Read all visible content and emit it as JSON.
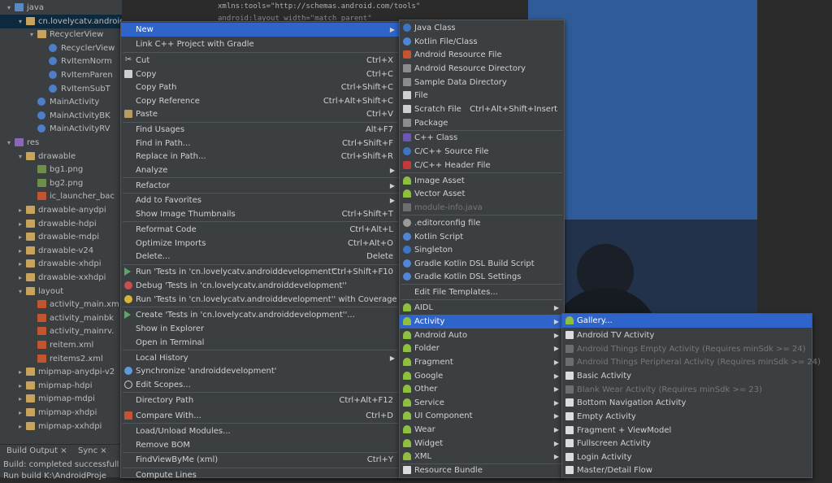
{
  "code": {
    "line1": "xmlns:tools=\"http://schemas.android.com/tools\"",
    "line2": "android:layout_width=\"match_parent\""
  },
  "tree": {
    "items": [
      {
        "label": "java",
        "icon": "folder-blue-icon",
        "arrow": "down"
      },
      {
        "label": "cn.lovelycatv.androiddevelop",
        "icon": "package-icon",
        "arrow": "down"
      },
      {
        "label": "RecyclerView",
        "icon": "folder-icon",
        "arrow": "down"
      },
      {
        "label": "RecyclerView",
        "icon": "kotlin-class-icon",
        "arrow": ""
      },
      {
        "label": "RvItemNorm",
        "icon": "kotlin-class-icon",
        "arrow": ""
      },
      {
        "label": "RvItemParen",
        "icon": "kotlin-class-icon",
        "arrow": ""
      },
      {
        "label": "RvItemSubT",
        "icon": "kotlin-class-icon",
        "arrow": ""
      },
      {
        "label": "MainActivity",
        "icon": "kotlin-class-icon",
        "arrow": ""
      },
      {
        "label": "MainActivityBK",
        "icon": "kotlin-class-icon",
        "arrow": ""
      },
      {
        "label": "MainActivityRV",
        "icon": "kotlin-class-icon",
        "arrow": ""
      },
      {
        "label": "res",
        "icon": "res-folder-icon",
        "arrow": "down"
      },
      {
        "label": "drawable",
        "icon": "folder-icon",
        "arrow": "down"
      },
      {
        "label": "bg1.png",
        "icon": "image-file-icon",
        "arrow": ""
      },
      {
        "label": "bg2.png",
        "icon": "image-file-icon",
        "arrow": ""
      },
      {
        "label": "ic_launcher_bac",
        "icon": "xml-file-icon",
        "arrow": ""
      },
      {
        "label": "drawable-anydpi",
        "icon": "folder-icon",
        "arrow": "right"
      },
      {
        "label": "drawable-hdpi",
        "icon": "folder-icon",
        "arrow": "right"
      },
      {
        "label": "drawable-mdpi",
        "icon": "folder-icon",
        "arrow": "right"
      },
      {
        "label": "drawable-v24",
        "icon": "folder-icon",
        "arrow": "right"
      },
      {
        "label": "drawable-xhdpi",
        "icon": "folder-icon",
        "arrow": "right"
      },
      {
        "label": "drawable-xxhdpi",
        "icon": "folder-icon",
        "arrow": "right"
      },
      {
        "label": "layout",
        "icon": "folder-icon",
        "arrow": "down"
      },
      {
        "label": "activity_main.xm",
        "icon": "xml-file-icon",
        "arrow": ""
      },
      {
        "label": "activity_mainbk",
        "icon": "xml-file-icon",
        "arrow": ""
      },
      {
        "label": "activity_mainrv.",
        "icon": "xml-file-icon",
        "arrow": ""
      },
      {
        "label": "reitem.xml",
        "icon": "xml-file-icon",
        "arrow": ""
      },
      {
        "label": "reitems2.xml",
        "icon": "xml-file-icon",
        "arrow": ""
      },
      {
        "label": "mipmap-anydpi-v2",
        "icon": "folder-icon",
        "arrow": "right"
      },
      {
        "label": "mipmap-hdpi",
        "icon": "folder-icon",
        "arrow": "right"
      },
      {
        "label": "mipmap-mdpi",
        "icon": "folder-icon",
        "arrow": "right"
      },
      {
        "label": "mipmap-xhdpi",
        "icon": "folder-icon",
        "arrow": "right"
      },
      {
        "label": "mipmap-xxhdpi",
        "icon": "folder-icon",
        "arrow": "right"
      }
    ]
  },
  "bottom": {
    "tab_build_output": "Build Output",
    "tab_sync": "Sync",
    "close_glyph": "×",
    "line1": "Build: completed successfull",
    "line2": "Run build K:\\AndroidProje"
  },
  "context_menu": {
    "new": "New",
    "link_cpp": "Link C++ Project with Gradle",
    "cut": "Cut",
    "cut_sc": "Ctrl+X",
    "copy": "Copy",
    "copy_sc": "Ctrl+C",
    "copy_path": "Copy Path",
    "copy_path_sc": "Ctrl+Shift+C",
    "copy_ref": "Copy Reference",
    "copy_ref_sc": "Ctrl+Alt+Shift+C",
    "paste": "Paste",
    "paste_sc": "Ctrl+V",
    "find_usages": "Find Usages",
    "find_usages_sc": "Alt+F7",
    "find_in_path": "Find in Path...",
    "find_in_path_sc": "Ctrl+Shift+F",
    "replace_in_path": "Replace in Path...",
    "replace_in_path_sc": "Ctrl+Shift+R",
    "analyze": "Analyze",
    "refactor": "Refactor",
    "add_favorites": "Add to Favorites",
    "show_thumbs": "Show Image Thumbnails",
    "show_thumbs_sc": "Ctrl+Shift+T",
    "reformat": "Reformat Code",
    "reformat_sc": "Ctrl+Alt+L",
    "optimize": "Optimize Imports",
    "optimize_sc": "Ctrl+Alt+O",
    "delete": "Delete...",
    "delete_sc": "Delete",
    "run_tests": "Run 'Tests in 'cn.lovelycatv.androiddevelopment''",
    "run_tests_sc": "Ctrl+Shift+F10",
    "debug_tests": "Debug 'Tests in 'cn.lovelycatv.androiddevelopment''",
    "run_cov": "Run 'Tests in 'cn.lovelycatv.androiddevelopment'' with Coverage",
    "create_tests": "Create 'Tests in 'cn.lovelycatv.androiddevelopment''...",
    "show_explorer": "Show in Explorer",
    "open_terminal": "Open in Terminal",
    "local_history": "Local History",
    "synchronize": "Synchronize 'androiddevelopment'",
    "edit_scopes": "Edit Scopes...",
    "dir_path": "Directory Path",
    "dir_path_sc": "Ctrl+Alt+F12",
    "compare_with": "Compare With...",
    "compare_with_sc": "Ctrl+D",
    "load_modules": "Load/Unload Modules...",
    "remove_bom": "Remove BOM",
    "findviewbyme": "FindViewByMe (xml)",
    "findviewbyme_sc": "Ctrl+Y",
    "compute_lines": "Compute Lines"
  },
  "new_menu": {
    "java_class": "Java Class",
    "kotlin_file": "Kotlin File/Class",
    "android_res_file": "Android Resource File",
    "android_res_dir": "Android Resource Directory",
    "sample_data_dir": "Sample Data Directory",
    "file": "File",
    "scratch_file": "Scratch File",
    "scratch_file_sc": "Ctrl+Alt+Shift+Insert",
    "package": "Package",
    "cpp_class": "C++ Class",
    "c_source": "C/C++ Source File",
    "c_header": "C/C++ Header File",
    "image_asset": "Image Asset",
    "vector_asset": "Vector Asset",
    "module_info": "module-info.java",
    "editorconfig": ".editorconfig file",
    "kotlin_script": "Kotlin Script",
    "singleton": "Singleton",
    "gradle_build": "Gradle Kotlin DSL Build Script",
    "gradle_settings": "Gradle Kotlin DSL Settings",
    "edit_templates": "Edit File Templates...",
    "aidl": "AIDL",
    "activity": "Activity",
    "android_auto": "Android Auto",
    "folder": "Folder",
    "fragment": "Fragment",
    "google": "Google",
    "other": "Other",
    "service": "Service",
    "ui_component": "UI Component",
    "wear": "Wear",
    "widget": "Widget",
    "xml": "XML",
    "resource_bundle": "Resource Bundle"
  },
  "activity_menu": {
    "gallery": "Gallery...",
    "android_tv": "Android TV Activity",
    "things_empty": "Android Things Empty Activity (Requires minSdk >= 24)",
    "things_peripheral": "Android Things Peripheral Activity (Requires minSdk >= 24)",
    "basic": "Basic Activity",
    "blank_wear": "Blank Wear Activity (Requires minSdk >= 23)",
    "bottom_nav": "Bottom Navigation Activity",
    "empty": "Empty Activity",
    "fragment_vm": "Fragment + ViewModel",
    "fullscreen": "Fullscreen Activity",
    "login": "Login Activity",
    "master_detail": "Master/Detail Flow"
  }
}
